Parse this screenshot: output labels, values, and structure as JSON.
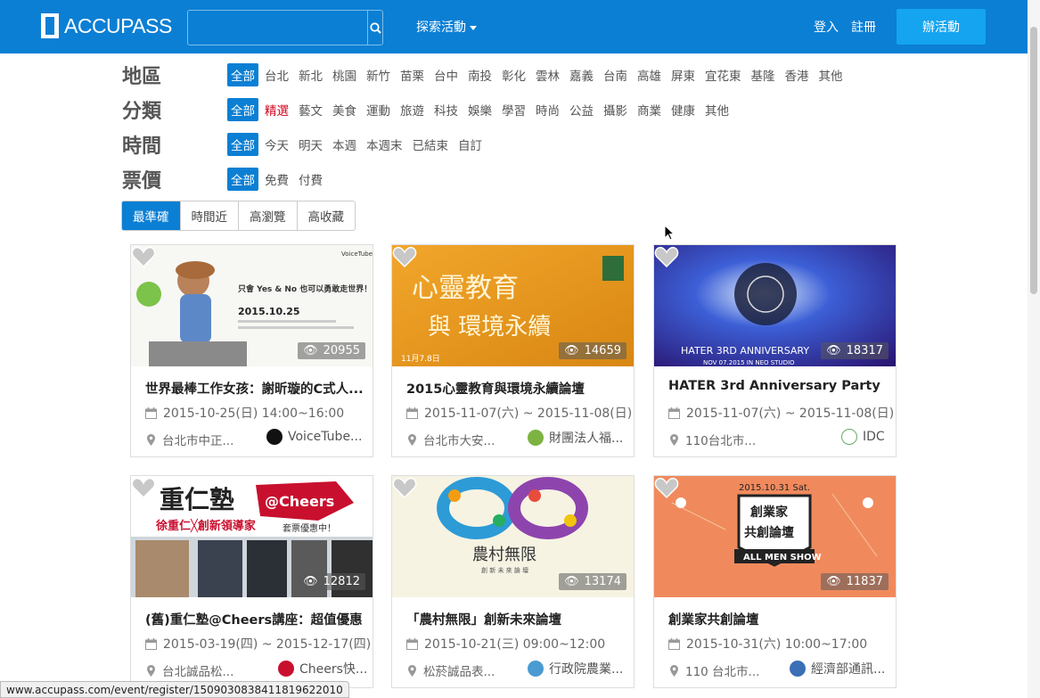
{
  "header": {
    "logo_text": "ACCUPASS",
    "search_placeholder": "",
    "explore_label": "探索活動",
    "login_label": "登入",
    "register_label": "註冊",
    "host_label": "辦活動"
  },
  "filters": {
    "region": {
      "title": "地區",
      "options": [
        "全部",
        "台北",
        "新北",
        "桃園",
        "新竹",
        "苗栗",
        "台中",
        "南投",
        "彰化",
        "雲林",
        "嘉義",
        "台南",
        "高雄",
        "屏東",
        "宜花東",
        "基隆",
        "香港",
        "其他"
      ]
    },
    "category": {
      "title": "分類",
      "options": [
        "全部",
        "精選",
        "藝文",
        "美食",
        "運動",
        "旅遊",
        "科技",
        "娛樂",
        "學習",
        "時尚",
        "公益",
        "攝影",
        "商業",
        "健康",
        "其他"
      ]
    },
    "time": {
      "title": "時間",
      "options": [
        "全部",
        "今天",
        "明天",
        "本週",
        "本週末",
        "已結束",
        "自訂"
      ]
    },
    "price": {
      "title": "票價",
      "options": [
        "全部",
        "免費",
        "付費"
      ]
    }
  },
  "sort": {
    "options": [
      "最準確",
      "時間近",
      "高瀏覽",
      "高收藏"
    ],
    "active": 0
  },
  "events": [
    {
      "title": "世界最棒工作女孩：謝昕璇的C式人...",
      "date": "2015-10-25(日) 14:00~16:00",
      "location": "台北市中正...",
      "organizer": "VoiceTube...",
      "views": "20955",
      "accent": "#7bc34a"
    },
    {
      "title": "2015心靈教育與環境永續論壇",
      "date": "2015-11-07(六) ~ 2015-11-08(日)",
      "location": "台北市大安...",
      "organizer": "財團法人福...",
      "views": "14659",
      "accent": "#e59a1a"
    },
    {
      "title": "HATER 3rd Anniversary Party",
      "date": "2015-11-07(六) ~ 2015-11-08(日)",
      "location": "110台北市...",
      "organizer": "IDC",
      "views": "18317",
      "accent": "#3a50c8"
    },
    {
      "title": "(舊)重仁塾@Cheers講座：超值優惠...",
      "date": "2015-03-19(四) ~ 2015-12-17(四)",
      "location": "台北誠品松...",
      "organizer": "Cheers快...",
      "views": "12812",
      "accent": "#c8102e"
    },
    {
      "title": "「農村無限」創新未來論壇",
      "date": "2015-10-21(三) 09:00~12:00",
      "location": "松菸誠品表...",
      "organizer": "行政院農業...",
      "views": "13174",
      "accent": "#2d9bd6"
    },
    {
      "title": "創業家共創論壇",
      "date": "2015-10-31(六) 10:00~17:00",
      "location": "110 台北市...",
      "organizer": "經濟部通訊...",
      "views": "11837",
      "accent": "#f08a5d"
    }
  ],
  "image_text": {
    "e1_headline": "只會 Yes & No 也可以勇敢走世界！",
    "e1_date": "2015.10.25",
    "e1_brand": "VoiceTube",
    "e2_line1": "心靈教育",
    "e2_line2": "與 環境永續",
    "e2_date": "11月7.8日",
    "e3_text": "HATER 3RD ANNIVERSARY",
    "e3_sub": "NOV 07.2015 IN NEO STUDIO",
    "e4_title": "重仁塾",
    "e4_brand": "@Cheers",
    "e4_sub": "徐重仁╳創新領導家",
    "e4_promo": "套票優惠中！",
    "e5_title": "農村無限",
    "e5_sub": "創 新 未 來 論 壇",
    "e6_date": "2015.10.31 Sat.",
    "e6_title1": "創業家",
    "e6_title2": "共創論壇",
    "e6_banner": "ALL MEN SHOW"
  },
  "statusbar_url": "www.accupass.com/event/register/1509030838411819622010",
  "colors": {
    "brand": "#0b7fd4",
    "host_button": "#14a4f0",
    "featured": "#d0021b"
  }
}
